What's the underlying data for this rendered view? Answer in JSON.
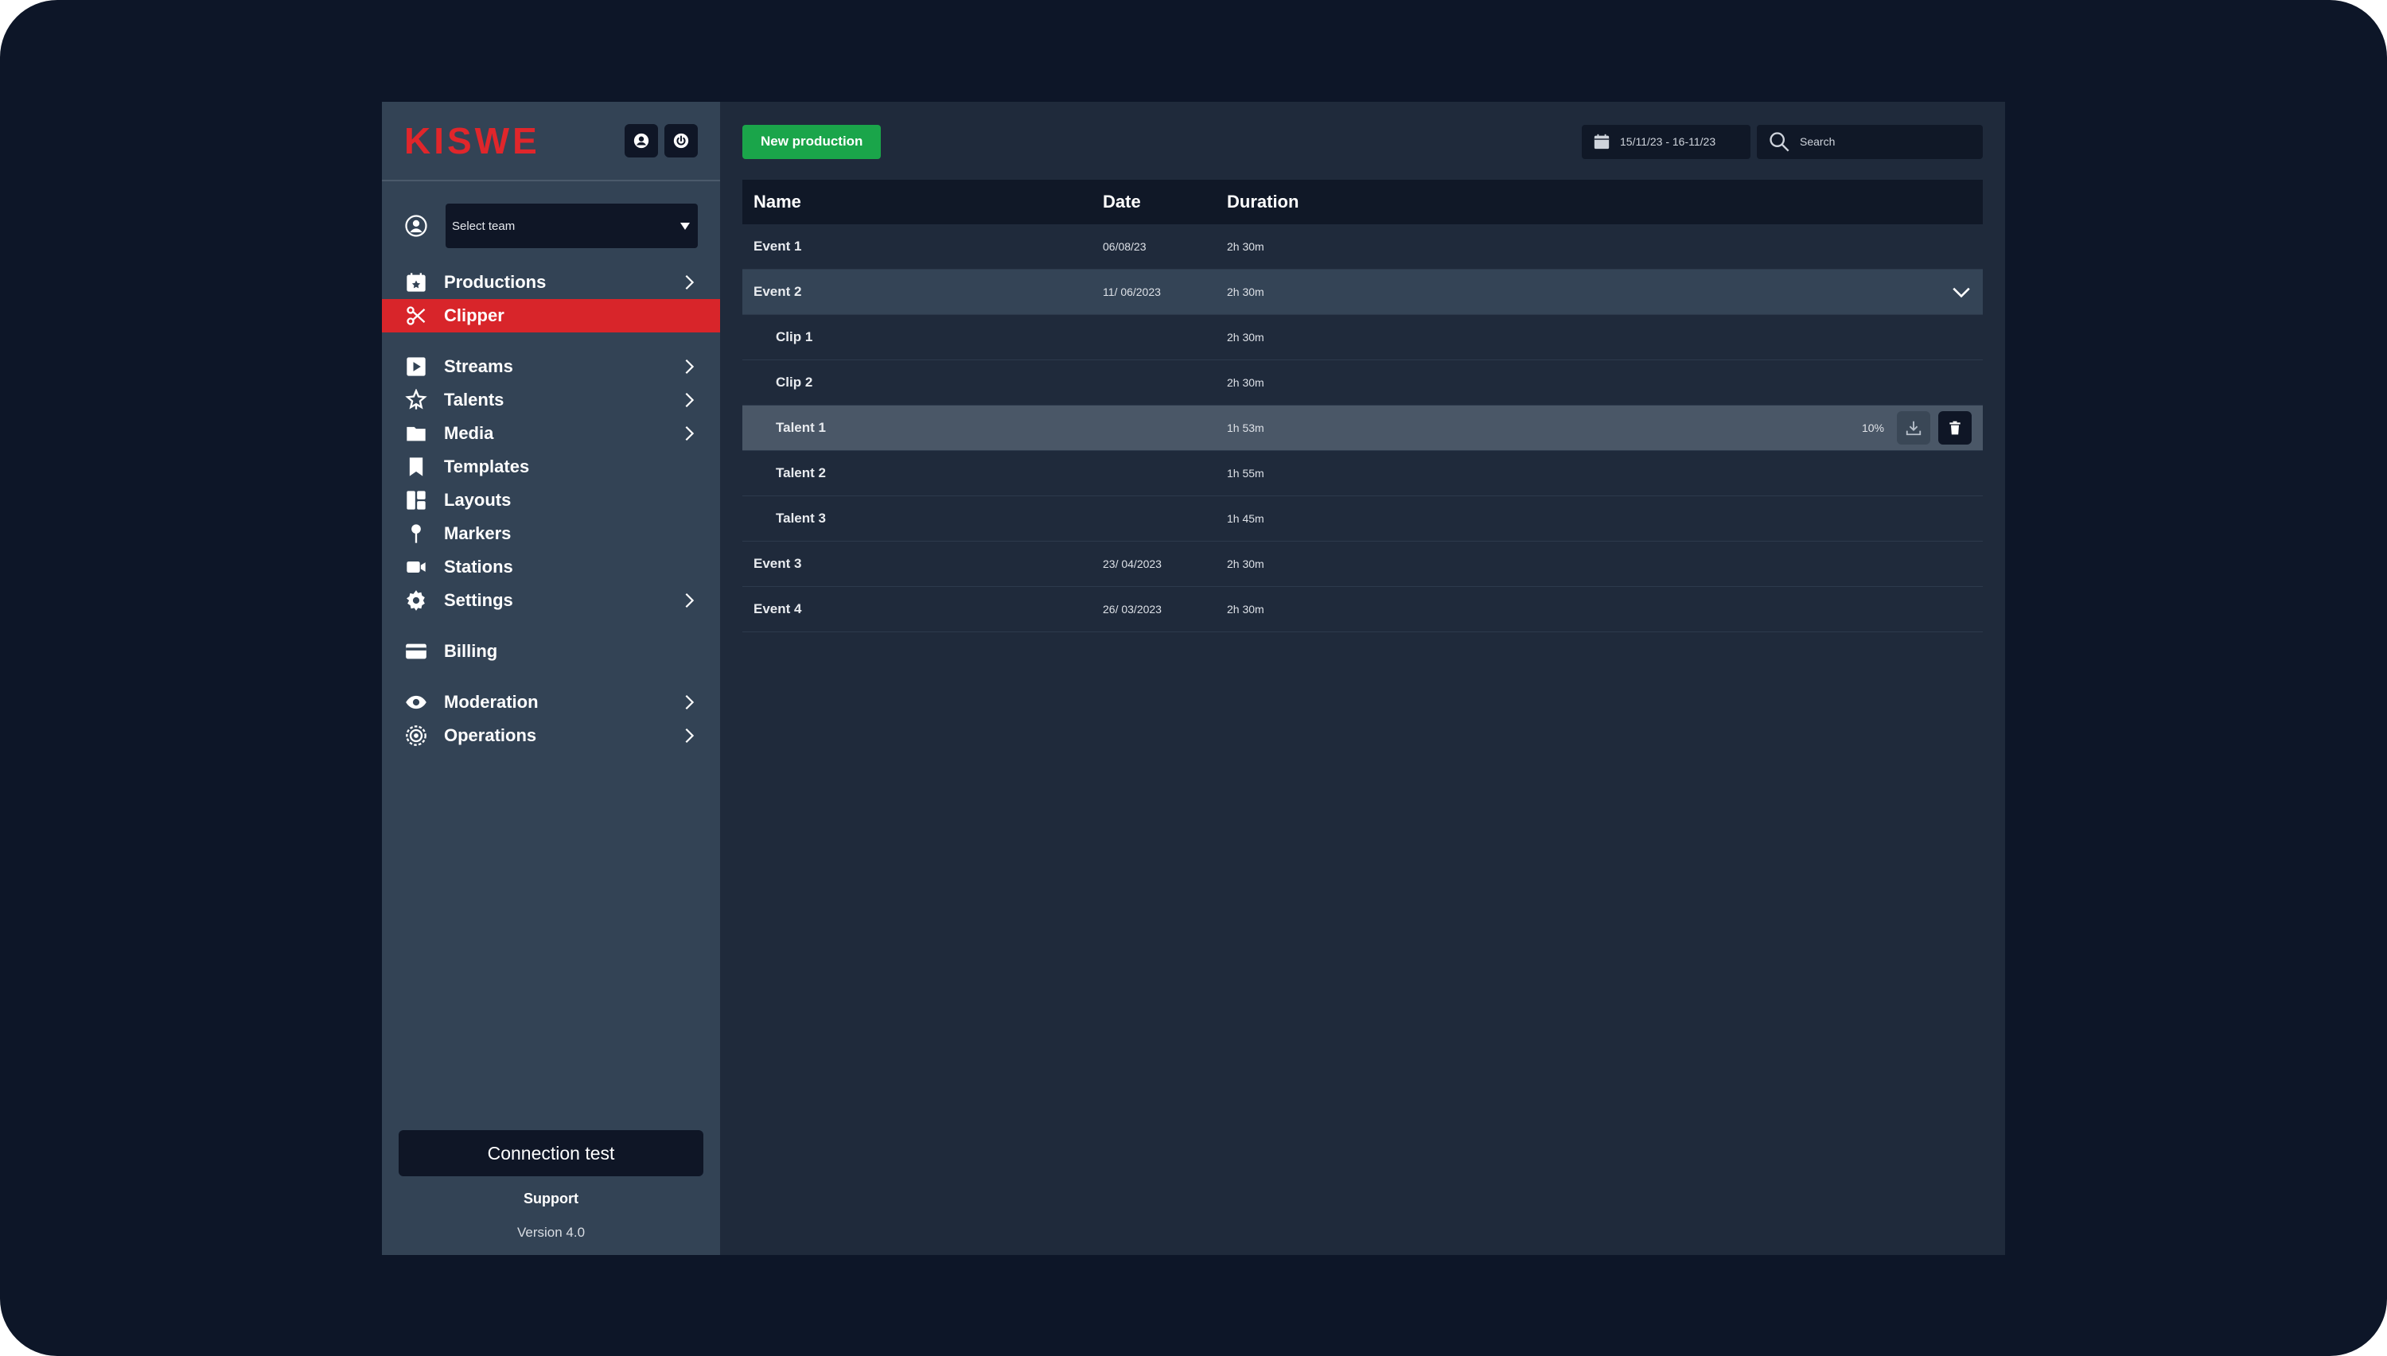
{
  "brand": {
    "logo": "KISWE",
    "accent": "#d8252a"
  },
  "sidebar": {
    "team_select": {
      "value": "Select team"
    },
    "items": [
      {
        "label": "Productions",
        "icon": "calendar-star-icon",
        "chevron": true
      },
      {
        "label": "Clipper",
        "icon": "scissors-icon",
        "active": true
      },
      {
        "label": "Streams",
        "icon": "play-icon",
        "chevron": true
      },
      {
        "label": "Talents",
        "icon": "star-person-icon",
        "chevron": true
      },
      {
        "label": "Media",
        "icon": "folder-icon",
        "chevron": true
      },
      {
        "label": "Templates",
        "icon": "bookmark-icon"
      },
      {
        "label": "Layouts",
        "icon": "layout-icon"
      },
      {
        "label": "Markers",
        "icon": "pin-icon"
      },
      {
        "label": "Stations",
        "icon": "video-camera-icon"
      },
      {
        "label": "Settings",
        "icon": "gear-icon",
        "chevron": true
      },
      {
        "label": "Billing",
        "icon": "credit-card-icon"
      },
      {
        "label": "Moderation",
        "icon": "eye-icon",
        "chevron": true
      },
      {
        "label": "Operations",
        "icon": "ops-gear-icon",
        "chevron": true
      }
    ],
    "connection_test": "Connection test",
    "support": "Support",
    "version": "Version 4.0"
  },
  "toolbar": {
    "new_production": "New production",
    "date_range": "15/11/23 - 16-11/23",
    "search_placeholder": "Search"
  },
  "table": {
    "columns": [
      "Name",
      "Date",
      "Duration"
    ],
    "rows": [
      {
        "name": "Event 1",
        "date": "06/08/23",
        "duration": "2h 30m"
      },
      {
        "name": "Event 2",
        "date": "11/ 06/2023",
        "duration": "2h 30m"
      },
      {
        "name": "Clip 1",
        "date": "",
        "duration": "2h 30m"
      },
      {
        "name": "Clip 2",
        "date": "",
        "duration": "2h 30m"
      },
      {
        "name": "Talent 1",
        "date": "",
        "duration": "1h 53m",
        "progress": "10%"
      },
      {
        "name": "Talent 2",
        "date": "",
        "duration": "1h 55m"
      },
      {
        "name": "Talent 3",
        "date": "",
        "duration": "1h 45m"
      },
      {
        "name": "Event 3",
        "date": "23/ 04/2023",
        "duration": "2h 30m"
      },
      {
        "name": "Event 4",
        "date": "26/ 03/2023",
        "duration": "2h 30m"
      }
    ]
  }
}
